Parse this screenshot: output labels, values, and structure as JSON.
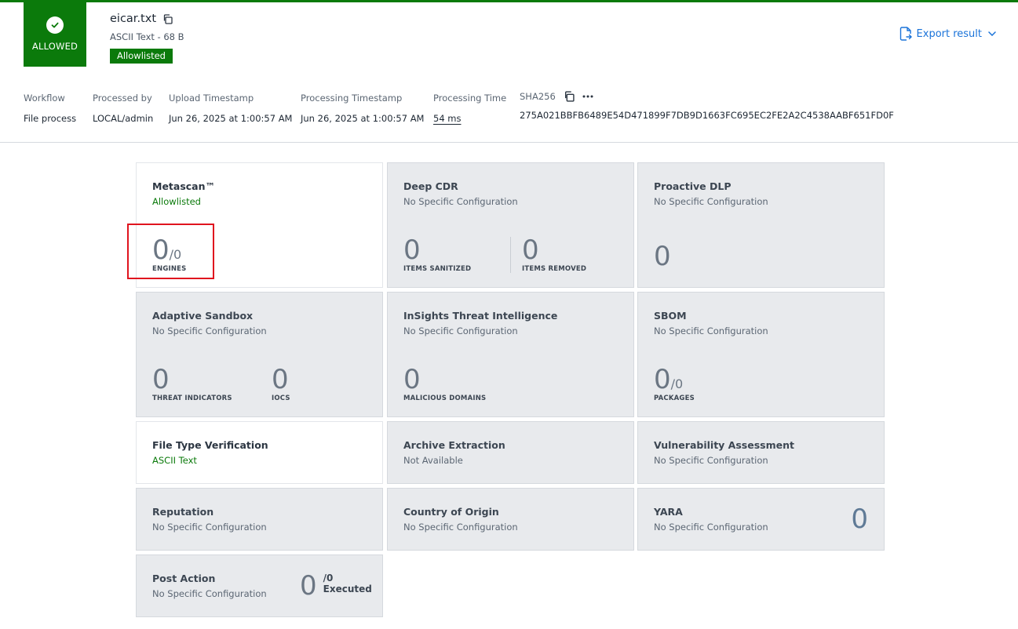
{
  "verdict": {
    "label": "ALLOWED",
    "color": "#0b7a0b"
  },
  "file": {
    "name": "eicar.txt",
    "meta": "ASCII Text - 68 B",
    "badge": "Allowlisted"
  },
  "export": {
    "label": "Export result"
  },
  "metadata": [
    {
      "key": "Workflow",
      "value": "File process"
    },
    {
      "key": "Processed by",
      "value": "LOCAL/admin"
    },
    {
      "key": "Upload Timestamp",
      "value": "Jun 26, 2025 at 1:00:57 AM"
    },
    {
      "key": "Processing Timestamp",
      "value": "Jun 26, 2025 at 1:00:57 AM"
    },
    {
      "key": "Processing Time",
      "value": "54 ms"
    },
    {
      "key": "SHA256",
      "value": "275A021BBFB6489E54D471899F7DB9D1663FC695EC2FE2A2C4538AABF651FD0F"
    }
  ],
  "cards": {
    "metascan": {
      "title": "Metascan™",
      "sub": "Allowlisted",
      "value": "0",
      "total": "/0",
      "caption": "ENGINES"
    },
    "deep_cdr": {
      "title": "Deep CDR",
      "sub": "No Specific Configuration",
      "v1": "0",
      "c1": "ITEMS SANITIZED",
      "v2": "0",
      "c2": "ITEMS REMOVED"
    },
    "proactive_dlp": {
      "title": "Proactive DLP",
      "sub": "No Specific Configuration",
      "value": "0"
    },
    "adaptive_sandbox": {
      "title": "Adaptive Sandbox",
      "sub": "No Specific Configuration",
      "v1": "0",
      "c1": "THREAT INDICATORS",
      "v2": "0",
      "c2": "IOCS"
    },
    "insights": {
      "title": "InSights Threat Intelligence",
      "sub": "No Specific Configuration",
      "value": "0",
      "caption": "MALICIOUS DOMAINS"
    },
    "sbom": {
      "title": "SBOM",
      "sub": "No Specific Configuration",
      "value": "0",
      "total": "/0",
      "caption": "PACKAGES"
    },
    "file_type": {
      "title": "File Type Verification",
      "sub": "ASCII Text"
    },
    "archive": {
      "title": "Archive Extraction",
      "sub": "Not Available"
    },
    "vulnerability": {
      "title": "Vulnerability Assessment",
      "sub": "No Specific Configuration"
    },
    "reputation": {
      "title": "Reputation",
      "sub": "No Specific Configuration"
    },
    "country": {
      "title": "Country of Origin",
      "sub": "No Specific Configuration"
    },
    "yara": {
      "title": "YARA",
      "sub": "No Specific Configuration",
      "value": "0"
    },
    "post_action": {
      "title": "Post Action",
      "sub": "No Specific Configuration",
      "value": "0",
      "total": "/0",
      "caption": "Executed"
    }
  }
}
